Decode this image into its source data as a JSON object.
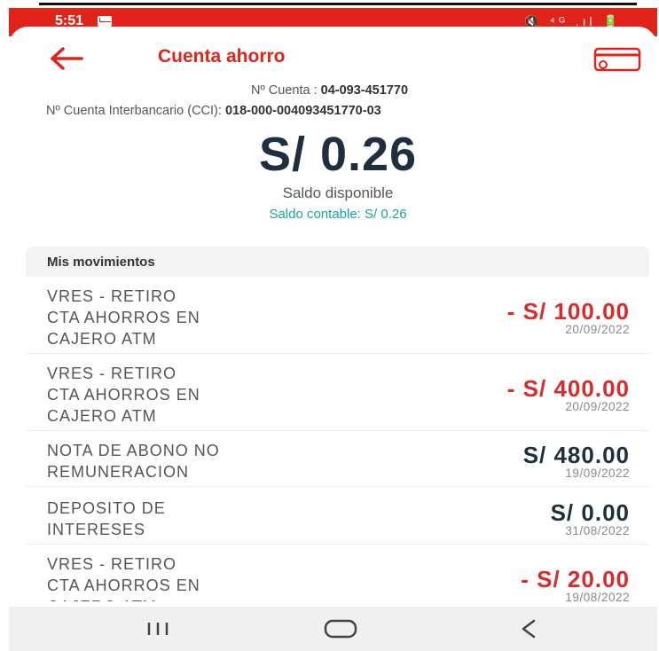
{
  "status_bar": {
    "time": "5:51",
    "right_icons": "🔇 ⁴ᴳ .ıl 🔋"
  },
  "header": {
    "title": "Cuenta ahorro"
  },
  "account": {
    "number_label": "Nº Cuenta :",
    "number": "04-093-451770",
    "cci_label": "Nº Cuenta Interbancario (CCI):",
    "cci": "018-000-004093451770-03"
  },
  "balance": {
    "amount": "S/ 0.26",
    "label": "Saldo disponible",
    "accounting": "Saldo contable:  S/ 0.26"
  },
  "movements": {
    "title": "Mis movimientos",
    "items": [
      {
        "desc": "VRES - RETIRO\nCTA AHORROS EN\nCAJERO ATM",
        "amount": "- S/ 100.00",
        "date": "20/09/2022",
        "type": "neg"
      },
      {
        "desc": "VRES - RETIRO\nCTA AHORROS EN\nCAJERO ATM",
        "amount": "- S/ 400.00",
        "date": "20/09/2022",
        "type": "neg"
      },
      {
        "desc": "NOTA DE ABONO NO\nREMUNERACION",
        "amount": "S/ 480.00",
        "date": "19/09/2022",
        "type": "pos"
      },
      {
        "desc": "DEPOSITO  DE\nINTERESES",
        "amount": "S/ 0.00",
        "date": "31/08/2022",
        "type": "pos"
      },
      {
        "desc": "VRES - RETIRO\nCTA AHORROS EN\nCAJERO ATM",
        "amount": "- S/ 20.00",
        "date": "19/08/2022",
        "type": "neg"
      }
    ]
  },
  "colors": {
    "brand_red": "#e2231a",
    "accent_teal": "#1aa39a",
    "dark": "#1f2f3d"
  }
}
